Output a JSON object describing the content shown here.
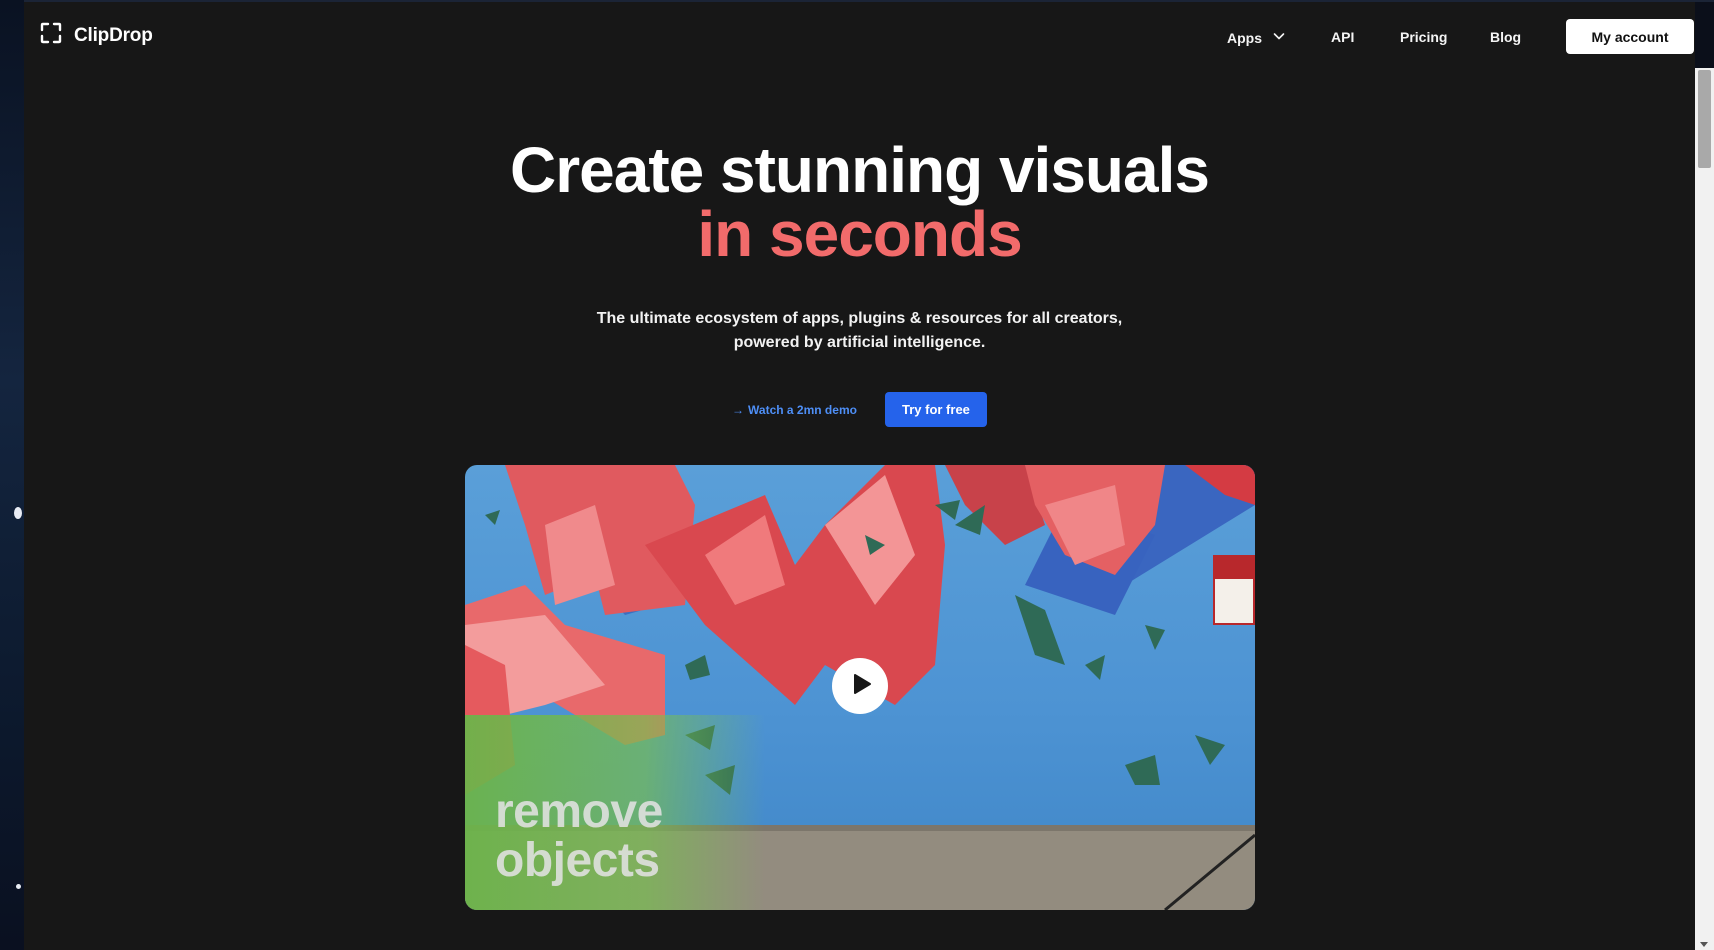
{
  "brand": {
    "name": "ClipDrop",
    "logo_icon": "frame-corners-icon"
  },
  "nav": {
    "apps_label": "Apps",
    "api_label": "API",
    "pricing_label": "Pricing",
    "blog_label": "Blog",
    "account_label": "My account"
  },
  "hero": {
    "title_line1": "Create stunning visuals",
    "title_line2": "in seconds",
    "accent_color": "#f26b6b",
    "subtitle_line1": "The ultimate ecosystem of apps, plugins & resources for all creators,",
    "subtitle_line2": "powered by artificial intelligence."
  },
  "cta": {
    "demo_arrow": "→",
    "demo_label": "Watch a 2mn demo",
    "try_label": "Try for free",
    "primary_color": "#2563eb"
  },
  "video": {
    "overlay_line1": "remove",
    "overlay_line2": "objects",
    "play_icon": "play-icon"
  }
}
